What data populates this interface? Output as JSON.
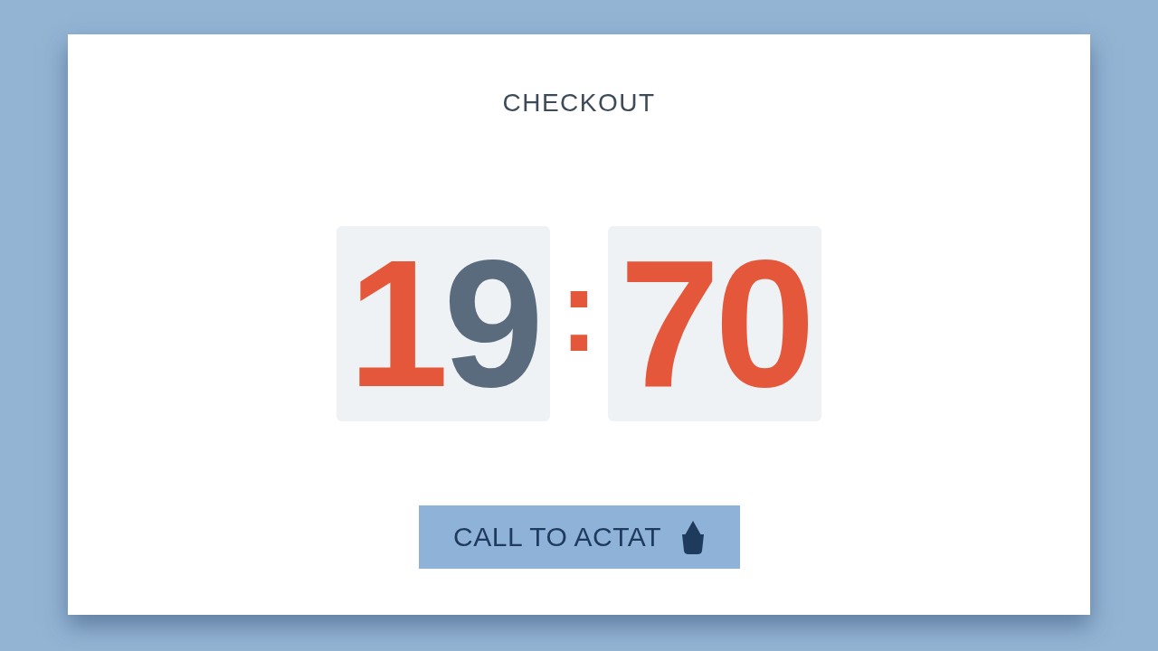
{
  "title": "CHECKOUT",
  "timer": {
    "groups": [
      {
        "digits": [
          {
            "text": "1",
            "color": "#e5573a"
          },
          {
            "text": "9",
            "color": "#5b6b7e"
          }
        ]
      },
      {
        "digits": [
          {
            "text": "7",
            "color": "#e5573a"
          },
          {
            "text": "0",
            "color": "#e5573a"
          }
        ]
      }
    ],
    "separator": {
      "text": ":",
      "color": "#e5573a"
    }
  },
  "button": {
    "label": "CALL TO ACTAT"
  }
}
